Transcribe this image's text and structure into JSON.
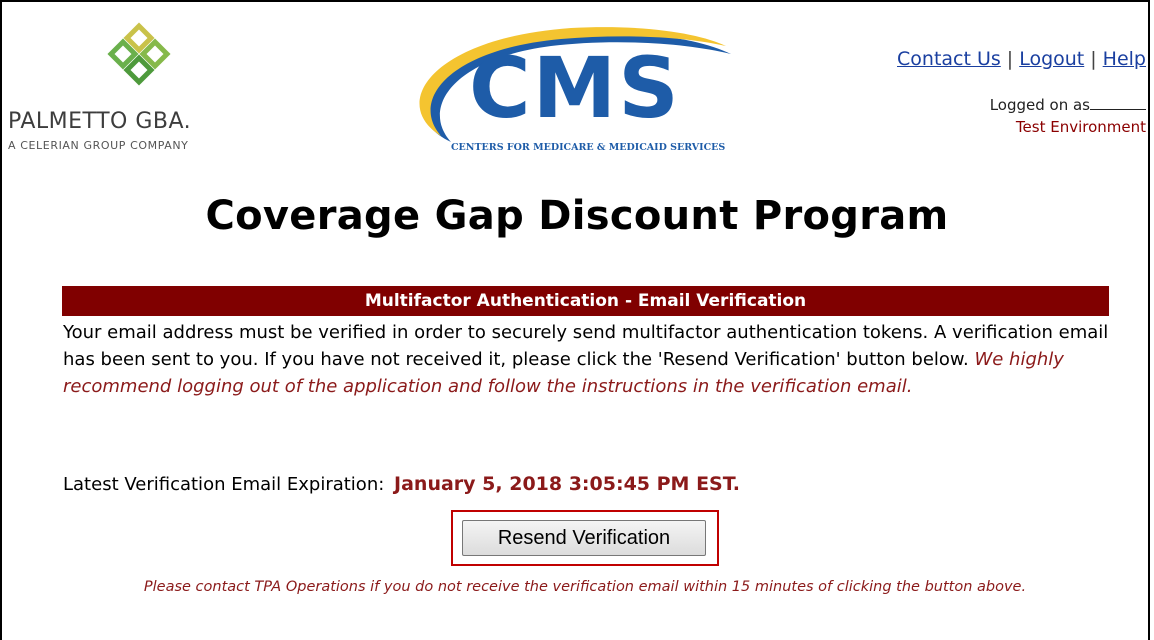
{
  "header": {
    "palmetto_name": "PALMETTO GBA.",
    "palmetto_tagline": "A CELERIAN GROUP COMPANY",
    "cms_word": "CMS",
    "cms_subtitle": "CENTERS FOR MEDICARE & MEDICAID SERVICES",
    "links": {
      "contact": "Contact Us",
      "logout": "Logout",
      "help": "Help",
      "separator": "|"
    },
    "logged_on_label": "Logged on as",
    "environment": "Test Environment"
  },
  "page_title": "Coverage Gap Discount Program",
  "section": {
    "title": "Multifactor Authentication - Email Verification",
    "body": "Your email address must be verified in order to securely send multifactor authentication tokens. A verification email has been sent to you. If you have not received it, please click the 'Resend Verification' button below.",
    "recommendation": "We highly recommend logging out of the application and follow the instructions in the verification email.",
    "expiration_label": "Latest Verification Email Expiration:",
    "expiration_value": "January 5, 2018 3:05:45 PM EST.",
    "resend_button": "Resend Verification",
    "note": "Please contact TPA Operations if you do not receive the verification email within 15 minutes of clicking the button above."
  },
  "colors": {
    "accent": "#800000",
    "link": "#1a3fa0",
    "cms_blue": "#1e5ca8"
  },
  "icons": {
    "palmetto_logo": "palmetto-leaf-icon",
    "cms_swoosh": "cms-swoosh-icon"
  }
}
